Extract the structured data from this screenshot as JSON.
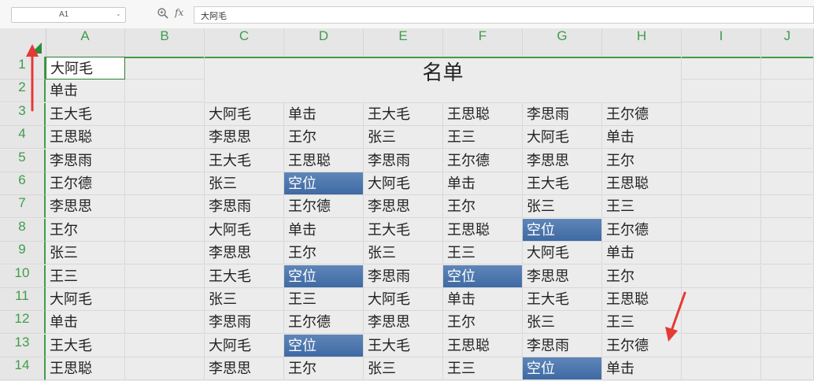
{
  "formula_bar": {
    "cell_ref": "A1",
    "fx_label": "fx",
    "formula_value": "大阿毛"
  },
  "columns": [
    "A",
    "B",
    "C",
    "D",
    "E",
    "F",
    "G",
    "H",
    "I",
    "J"
  ],
  "rows": [
    "1",
    "2",
    "3",
    "4",
    "5",
    "6",
    "7",
    "8",
    "9",
    "10",
    "11",
    "12",
    "13",
    "14"
  ],
  "title": "名单",
  "col_a": [
    "大阿毛",
    "单击",
    "王大毛",
    "王思聪",
    "李思雨",
    "王尔德",
    "李思思",
    "王尔",
    "张三",
    "王三",
    "大阿毛",
    "单击",
    "王大毛",
    "王思聪"
  ],
  "table": [
    [
      "大阿毛",
      "单击",
      "王大毛",
      "王思聪",
      "李思雨",
      "王尔德"
    ],
    [
      "李思思",
      "王尔",
      "张三",
      "王三",
      "大阿毛",
      "单击"
    ],
    [
      "王大毛",
      "王思聪",
      "李思雨",
      "王尔德",
      "李思思",
      "王尔"
    ],
    [
      "张三",
      "空位",
      "大阿毛",
      "单击",
      "王大毛",
      "王思聪"
    ],
    [
      "李思雨",
      "王尔德",
      "李思思",
      "王尔",
      "张三",
      "王三"
    ],
    [
      "大阿毛",
      "单击",
      "王大毛",
      "王思聪",
      "空位",
      "王尔德"
    ],
    [
      "李思思",
      "王尔",
      "张三",
      "王三",
      "大阿毛",
      "单击"
    ],
    [
      "王大毛",
      "空位",
      "李思雨",
      "空位",
      "李思思",
      "王尔"
    ],
    [
      "张三",
      "王三",
      "大阿毛",
      "单击",
      "王大毛",
      "王思聪"
    ],
    [
      "李思雨",
      "王尔德",
      "李思思",
      "王尔",
      "张三",
      "王三"
    ],
    [
      "大阿毛",
      "空位",
      "王大毛",
      "王思聪",
      "李思雨",
      "王尔德"
    ],
    [
      "李思思",
      "王尔",
      "张三",
      "王三",
      "空位",
      "单击"
    ]
  ],
  "highlight_text": "空位",
  "colors": {
    "header_text": "#3f9d4a",
    "highlight_fill": "#4a74aa",
    "annotation_arrow": "#e53935"
  },
  "icons": {
    "zoom": "zoom-icon",
    "dropdown": "chevron-down-icon",
    "select_all": "select-all-corner-icon"
  }
}
